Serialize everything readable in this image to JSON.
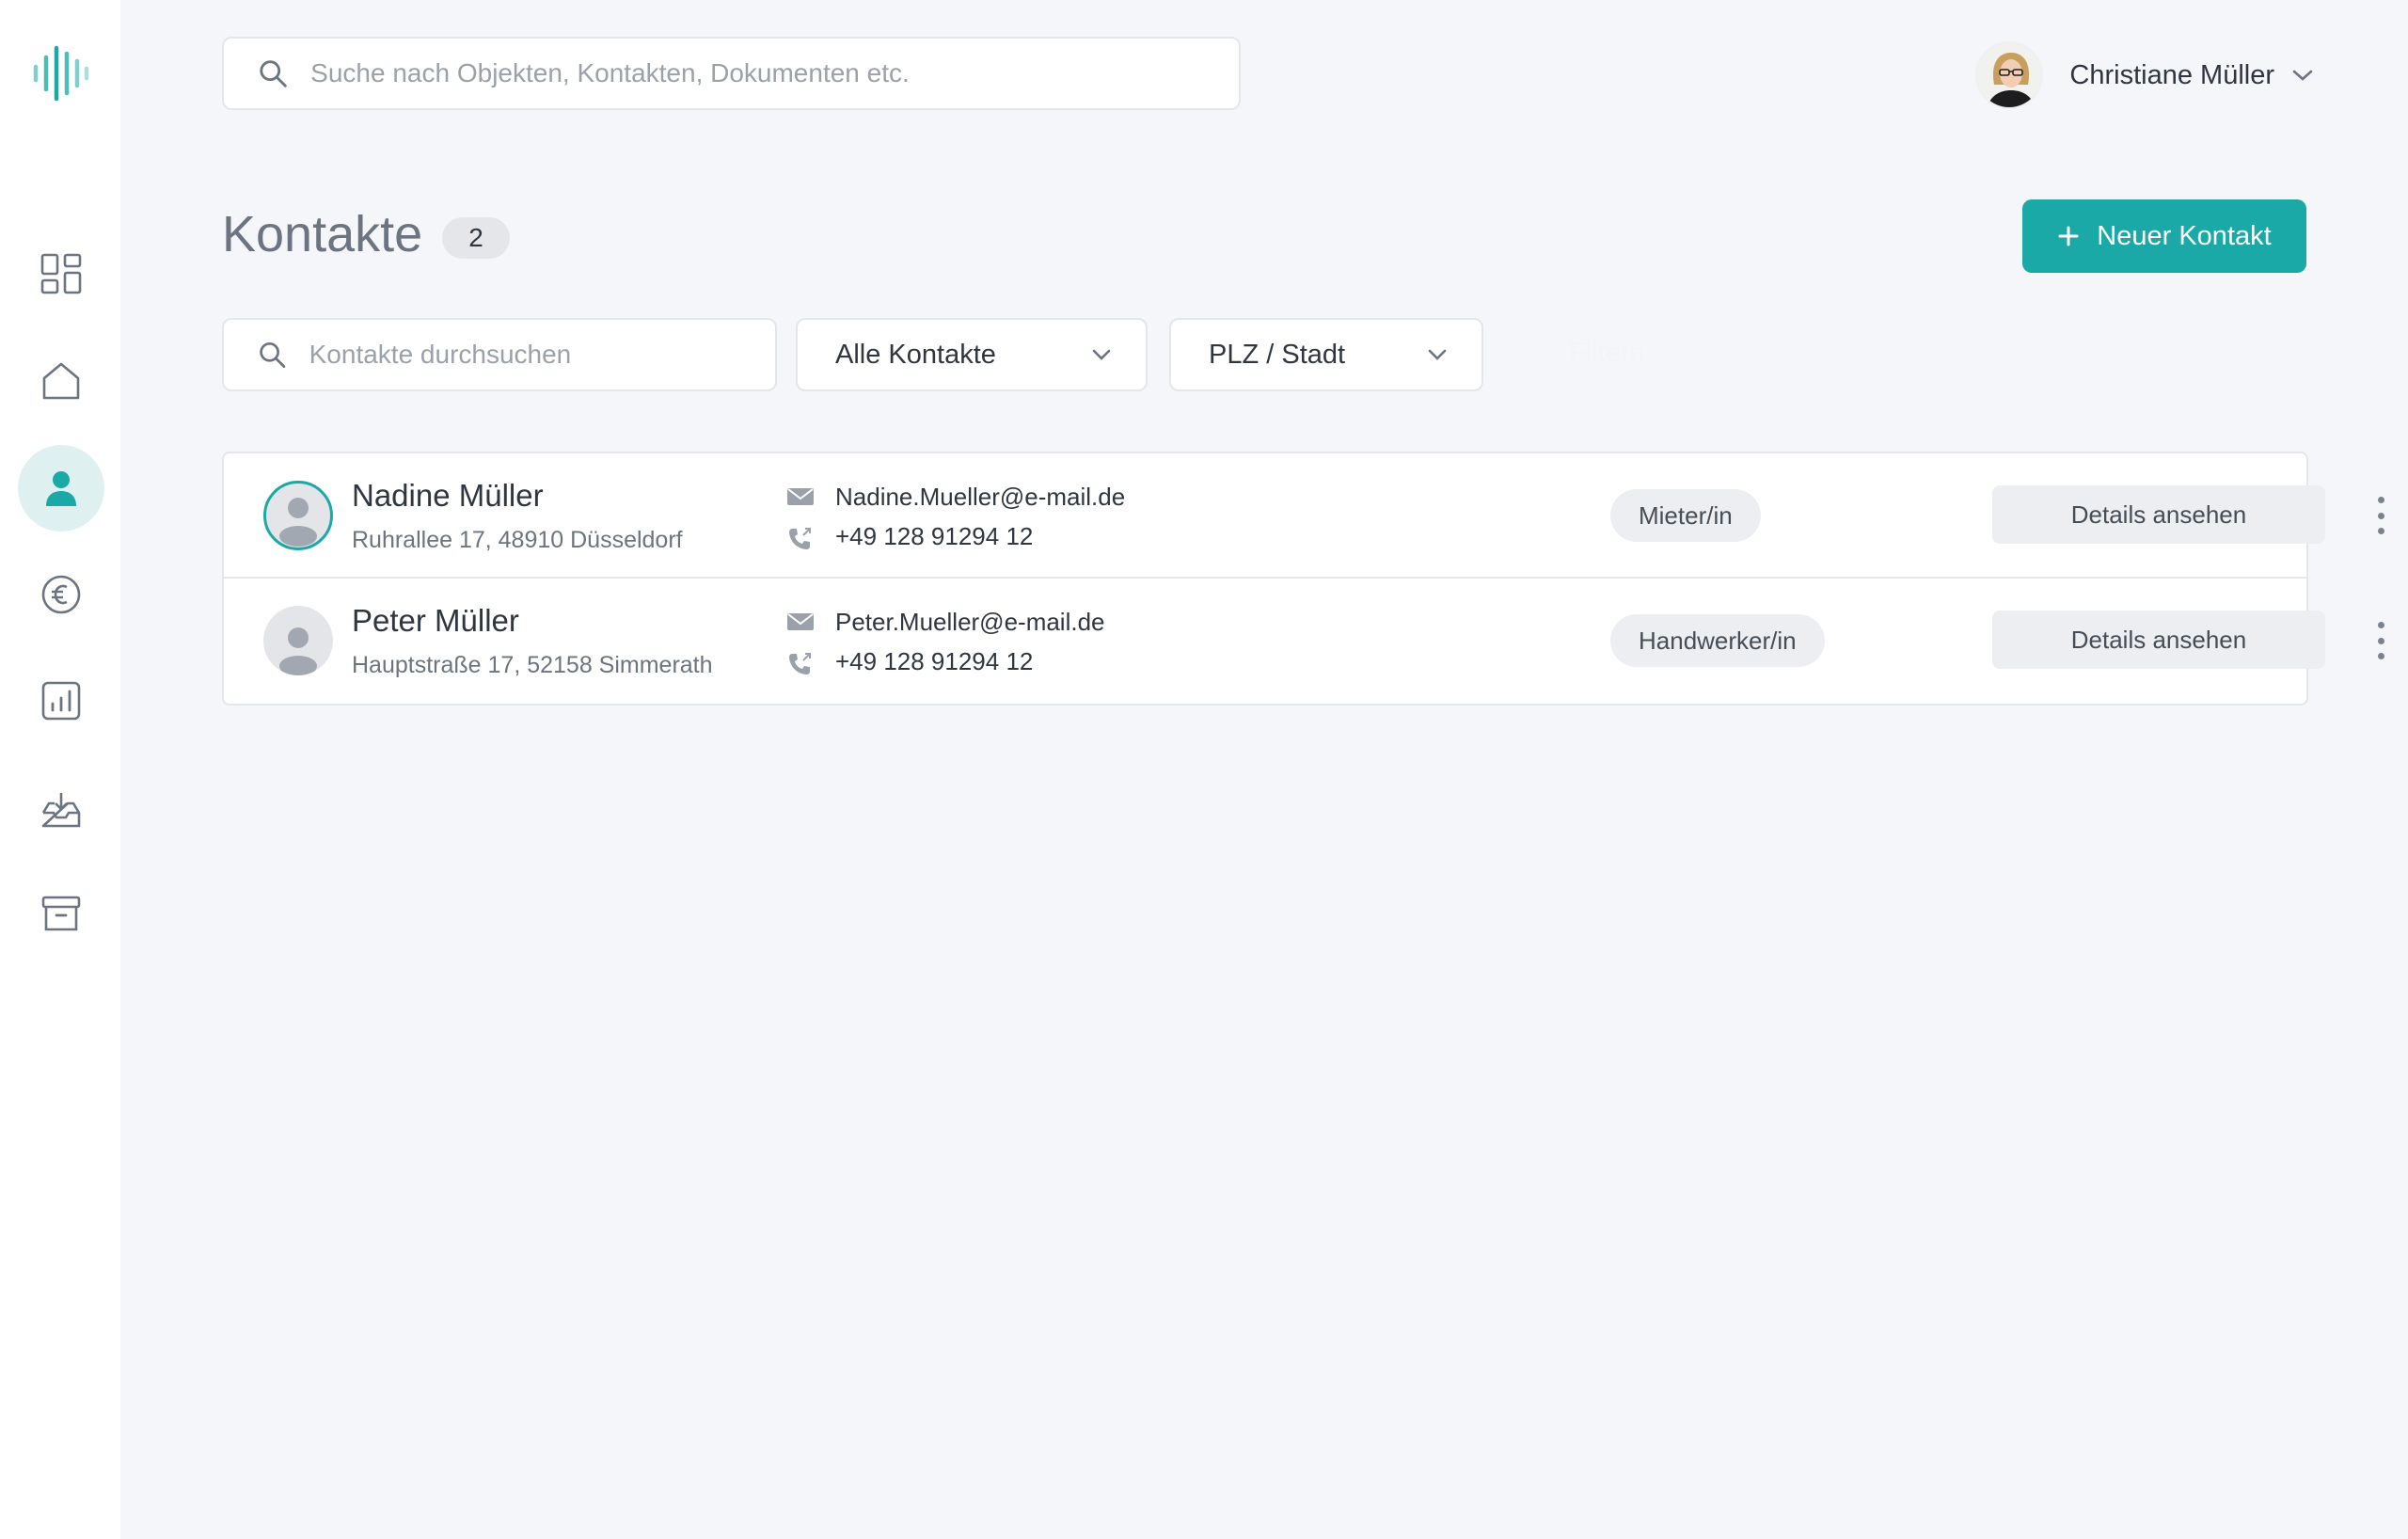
{
  "header": {
    "search_placeholder": "Suche nach Objekten, Kontakten, Dokumenten etc.",
    "user_name": "Christiane Müller"
  },
  "sidebar": {
    "items": [
      {
        "icon": "dashboard-icon",
        "active": false
      },
      {
        "icon": "home-icon",
        "active": false
      },
      {
        "icon": "contacts-icon",
        "active": true
      },
      {
        "icon": "euro-icon",
        "active": false
      },
      {
        "icon": "chart-icon",
        "active": false
      },
      {
        "icon": "inbox-icon",
        "active": false
      },
      {
        "icon": "archive-icon",
        "active": false
      }
    ]
  },
  "page": {
    "title": "Kontakte",
    "count": "2",
    "new_button": "Neuer Kontakt"
  },
  "filters": {
    "search_placeholder": "Kontakte durchsuchen",
    "type_select": "Alle Kontakte",
    "city_select": "PLZ / Stadt",
    "filter_link": "Filtern"
  },
  "contacts": [
    {
      "name": "Nadine Müller",
      "address": "Ruhrallee 17, 48910 Düsseldorf",
      "email": "Nadine.Mueller@e-mail.de",
      "phone": "+49 128 91294 12",
      "role": "Mieter/in",
      "details": "Details ansehen"
    },
    {
      "name": "Peter Müller",
      "address": "Hauptstraße 17, 52158 Simmerath",
      "email": "Peter.Mueller@e-mail.de",
      "phone": "+49 128 91294 12",
      "role": "Handwerker/in",
      "details": "Details ansehen"
    }
  ],
  "colors": {
    "accent": "#1aa9a6",
    "background": "#f5f6fa",
    "active_nav": "#dff0f0"
  }
}
